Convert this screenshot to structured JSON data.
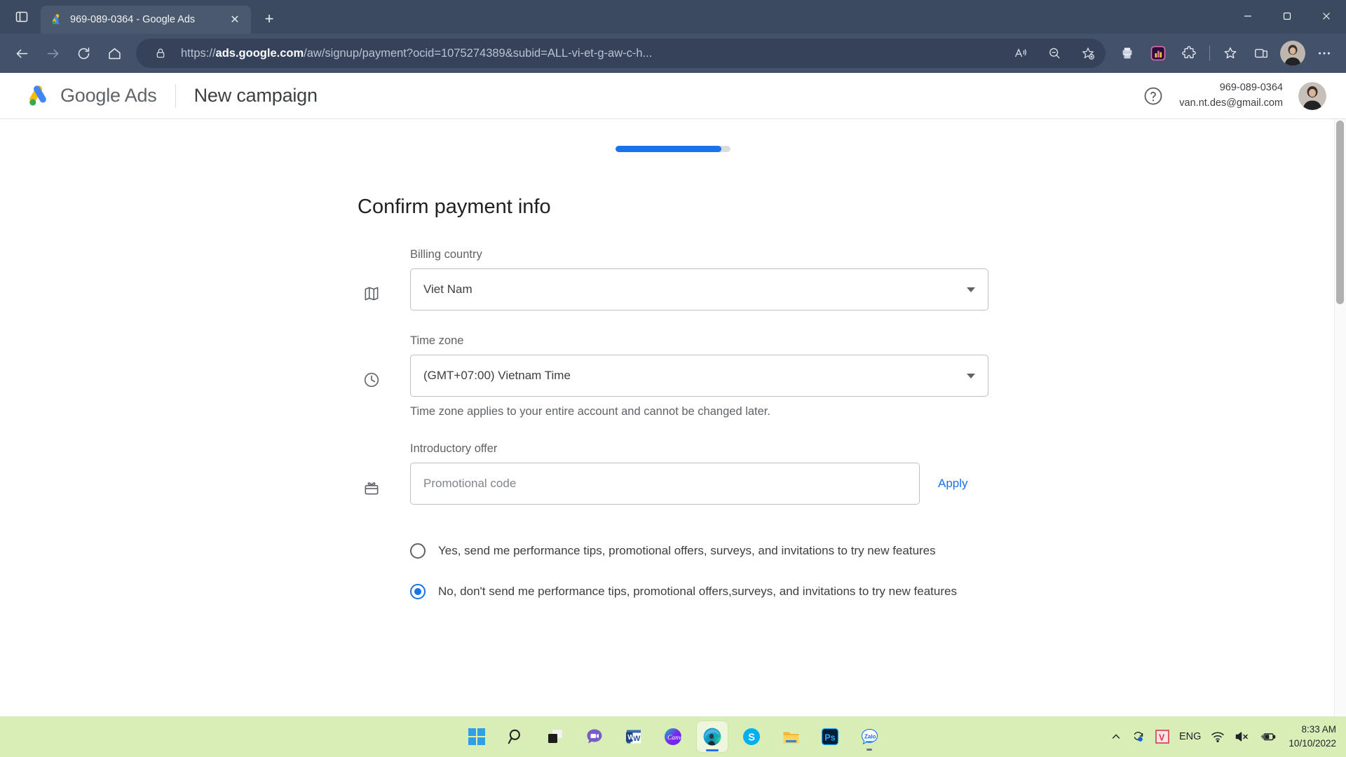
{
  "browser": {
    "tab": {
      "title": "969-089-0364 - Google Ads",
      "favicon_name": "google-ads-favicon",
      "close_label": "✕"
    },
    "new_tab_label": "+",
    "tab_actions_icon": "tab-actions-icon",
    "window_controls": {
      "minimize": "—",
      "maximize": "☐",
      "close": "✕"
    },
    "nav": {
      "back": "back-arrow-icon",
      "forward": "forward-arrow-icon",
      "refresh": "refresh-icon",
      "home": "home-icon"
    },
    "omnibox": {
      "lock_icon": "lock-icon",
      "url_scheme": "https://",
      "url_domain": "ads.google.com",
      "url_path": "/aw/signup/payment?ocid=1075274389&subid=ALL-vi-et-g-aw-c-h...",
      "full_url": "https://ads.google.com/aw/signup/payment?ocid=1075274389&subid=ALL-vi-et-g-aw-c-h...",
      "read_aloud_icon": "read-aloud-icon",
      "zoom_out_icon": "zoom-out-icon",
      "add_favorite_icon": "add-favorite-star-icon"
    },
    "toolbar_icons": [
      {
        "name": "print-extension-icon"
      },
      {
        "name": "analytics-extension-icon"
      },
      {
        "name": "extensions-puzzle-icon"
      },
      {
        "name": "collections-favorites-icon"
      },
      {
        "name": "browser-essentials-icon"
      },
      {
        "name": "profile-avatar-icon"
      },
      {
        "name": "settings-and-more-icon"
      }
    ]
  },
  "page": {
    "header": {
      "logo_text_google": "Google",
      "logo_text_ads": "Ads",
      "page_title": "New campaign",
      "help_icon": "help-question-icon",
      "account_id": "969-089-0364",
      "account_email": "van.nt.des@gmail.com",
      "avatar_name": "account-avatar"
    },
    "progress": {
      "percent": 92,
      "label": "Signup progress"
    },
    "form": {
      "title": "Confirm payment info",
      "billing_country": {
        "icon": "map-icon",
        "label": "Billing country",
        "value": "Viet Nam",
        "caret_icon": "chevron-down-icon"
      },
      "time_zone": {
        "icon": "clock-icon",
        "label": "Time zone",
        "value": "(GMT+07:00) Vietnam Time",
        "caret_icon": "chevron-down-icon",
        "helper": "Time zone applies to your entire account and cannot be changed later."
      },
      "introductory_offer": {
        "icon": "gift-card-icon",
        "label": "Introductory offer",
        "placeholder": "Promotional code",
        "value": "",
        "apply_label": "Apply"
      },
      "email_preferences": {
        "options": [
          {
            "label": "Yes, send me performance tips, promotional offers, surveys, and invitations to try new features",
            "selected": false
          },
          {
            "label": "No, don't send me performance tips, promotional offers,surveys, and invitations to try new features",
            "selected": true
          }
        ]
      }
    }
  },
  "taskbar": {
    "items": [
      {
        "name": "start-button",
        "label": "Start"
      },
      {
        "name": "search-icon",
        "label": "Search"
      },
      {
        "name": "task-view-icon",
        "label": "Task View"
      },
      {
        "name": "chat-teams-icon",
        "label": "Chat"
      },
      {
        "name": "word-icon",
        "label": "Word"
      },
      {
        "name": "canva-icon",
        "label": "Canva"
      },
      {
        "name": "edge-browser-icon",
        "label": "Microsoft Edge"
      },
      {
        "name": "skype-icon",
        "label": "Skype"
      },
      {
        "name": "file-explorer-icon",
        "label": "File Explorer"
      },
      {
        "name": "photoshop-icon",
        "label": "Photoshop"
      },
      {
        "name": "zalo-icon",
        "label": "Zalo"
      }
    ],
    "tray": {
      "show_hidden_icon": "chevron-up-icon",
      "sync_icon": "onedrive-sync-icon",
      "unikey_icon": "unikey-v-icon",
      "language": "ENG",
      "wifi_icon": "wifi-icon",
      "volume_icon": "volume-muted-icon",
      "battery_icon": "battery-charging-icon",
      "time": "8:33 AM",
      "date": "10/10/2022"
    }
  },
  "colors": {
    "accent_blue": "#1a73e8",
    "browser_chrome": "#3b4a5e",
    "taskbar_green": "#d9edb6",
    "text_primary": "#3c4043",
    "text_secondary": "#5f6368"
  }
}
